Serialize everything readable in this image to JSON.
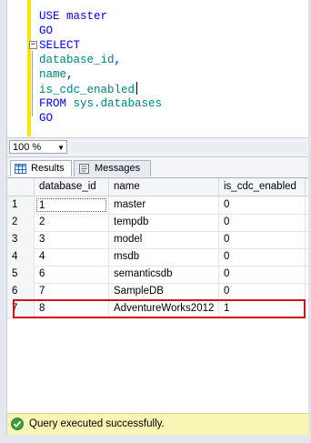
{
  "editor": {
    "lines": [
      {
        "parts": [
          {
            "t": "USE ",
            "c": "kw"
          },
          {
            "t": "master",
            "c": "kw"
          }
        ]
      },
      {
        "parts": [
          {
            "t": "GO",
            "c": "kw"
          }
        ]
      },
      {
        "parts": [
          {
            "t": "SELECT",
            "c": "kw"
          }
        ]
      },
      {
        "parts": [
          {
            "t": "database_id",
            "c": "id"
          },
          {
            "t": ",",
            "c": "kw"
          }
        ]
      },
      {
        "parts": [
          {
            "t": "name",
            "c": "id"
          },
          {
            "t": ",",
            "c": "kw"
          }
        ]
      },
      {
        "parts": [
          {
            "t": "is_cdc_enabled",
            "c": "id"
          }
        ]
      },
      {
        "parts": [
          {
            "t": "FROM ",
            "c": "kw"
          },
          {
            "t": "sys.databases",
            "c": "id"
          }
        ]
      },
      {
        "parts": [
          {
            "t": "GO",
            "c": "kw"
          }
        ]
      }
    ],
    "collapse_symbol": "−"
  },
  "zoom": {
    "value": "100 %"
  },
  "tabs": {
    "results": "Results",
    "messages": "Messages"
  },
  "grid": {
    "columns": [
      "database_id",
      "name",
      "is_cdc_enabled"
    ],
    "rows": [
      {
        "num": "1",
        "database_id": "1",
        "name": "master",
        "is_cdc_enabled": "0"
      },
      {
        "num": "2",
        "database_id": "2",
        "name": "tempdb",
        "is_cdc_enabled": "0"
      },
      {
        "num": "3",
        "database_id": "3",
        "name": "model",
        "is_cdc_enabled": "0"
      },
      {
        "num": "4",
        "database_id": "4",
        "name": "msdb",
        "is_cdc_enabled": "0"
      },
      {
        "num": "5",
        "database_id": "6",
        "name": "semanticsdb",
        "is_cdc_enabled": "0"
      },
      {
        "num": "6",
        "database_id": "7",
        "name": "SampleDB",
        "is_cdc_enabled": "0"
      },
      {
        "num": "7",
        "database_id": "8",
        "name": "AdventureWorks2012",
        "is_cdc_enabled": "1"
      }
    ],
    "highlight_row_index": 6,
    "highlight_color": "#d0141a"
  },
  "status": {
    "text": "Query executed successfully.",
    "bg": "#f8f5b5"
  }
}
